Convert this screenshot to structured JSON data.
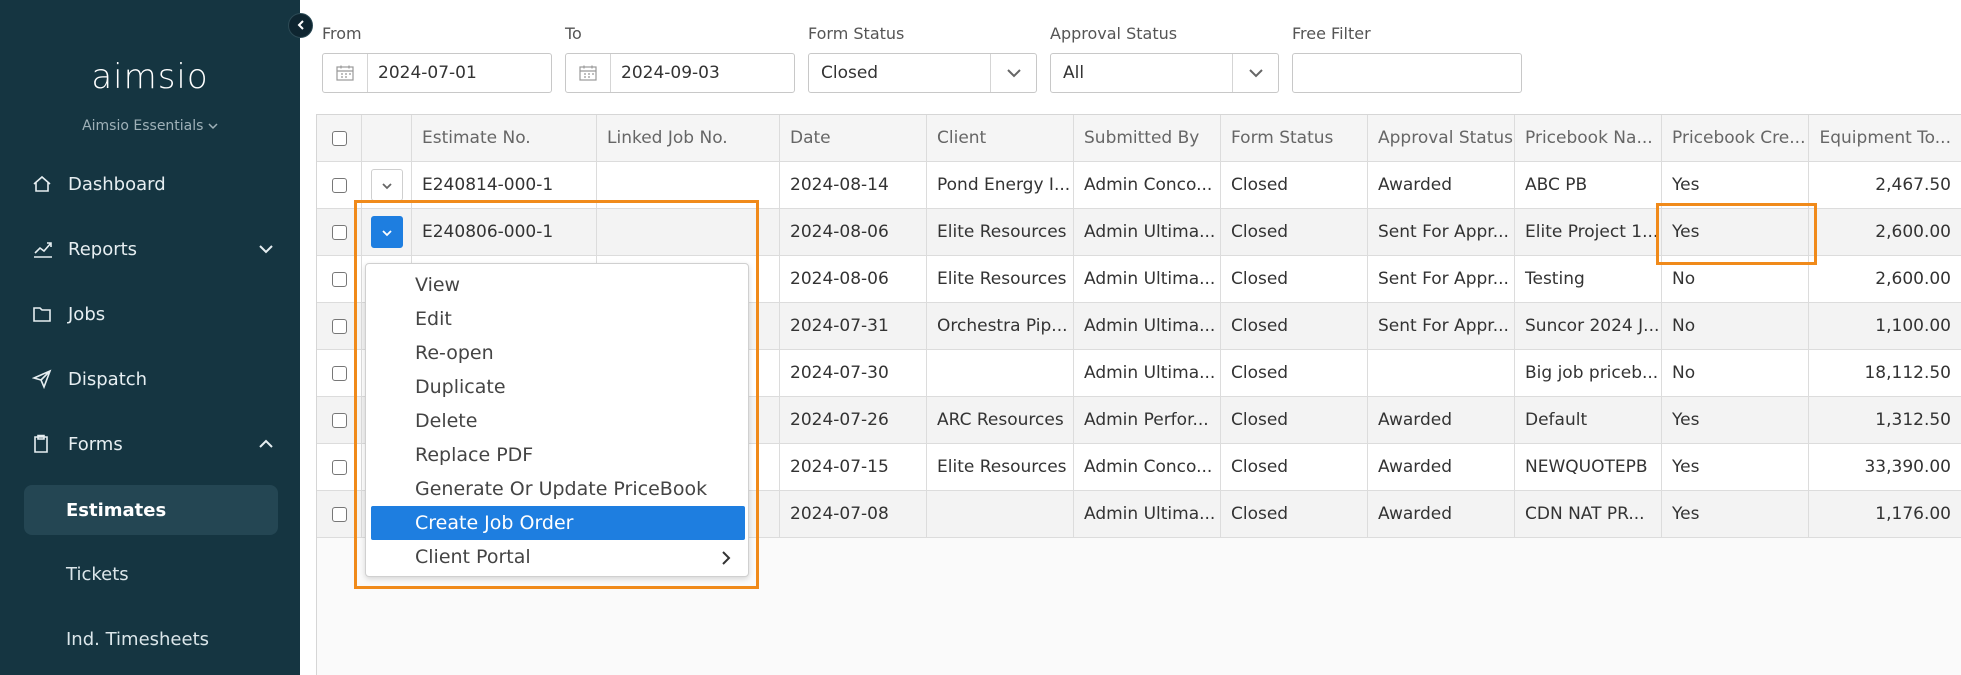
{
  "sidebar": {
    "logo": "aimsio",
    "org_name": "Aimsio Essentials",
    "nav": [
      {
        "label": "Dashboard",
        "icon": "home-icon"
      },
      {
        "label": "Reports",
        "icon": "chart-icon"
      },
      {
        "label": "Jobs",
        "icon": "folder-icon"
      },
      {
        "label": "Dispatch",
        "icon": "paper-plane-icon"
      },
      {
        "label": "Forms",
        "icon": "clipboard-icon"
      }
    ],
    "sub_items": [
      "Estimates",
      "Tickets",
      "Ind. Timesheets"
    ]
  },
  "filters": {
    "from_label": "From",
    "from_value": "2024-07-01",
    "to_label": "To",
    "to_value": "2024-09-03",
    "form_status_label": "Form Status",
    "form_status_value": "Closed",
    "approval_status_label": "Approval Status",
    "approval_status_value": "All",
    "free_filter_label": "Free Filter",
    "free_filter_value": ""
  },
  "table": {
    "columns": [
      "Estimate No.",
      "Linked Job No.",
      "Date",
      "Client",
      "Submitted By",
      "Form Status",
      "Approval Status",
      "Pricebook Na...",
      "Pricebook Cre...",
      "Equipment To..."
    ],
    "rows": [
      [
        "E240814-000-1",
        "",
        "2024-08-14",
        "Pond Energy I...",
        "Admin Conco...",
        "Closed",
        "Awarded",
        "ABC PB",
        "Yes",
        "2,467.50"
      ],
      [
        "E240806-000-1",
        "",
        "2024-08-06",
        "Elite Resources",
        "Admin Ultima...",
        "Closed",
        "Sent For Appr...",
        "Elite Project 1...",
        "Yes",
        "2,600.00"
      ],
      [
        "",
        "",
        "2024-08-06",
        "Elite Resources",
        "Admin Ultima...",
        "Closed",
        "Sent For Appr...",
        "Testing",
        "No",
        "2,600.00"
      ],
      [
        "",
        "",
        "2024-07-31",
        "Orchestra Pip...",
        "Admin Ultima...",
        "Closed",
        "Sent For Appr...",
        "Suncor 2024 J...",
        "No",
        "1,100.00"
      ],
      [
        "",
        "",
        "2024-07-30",
        "",
        "Admin Ultima...",
        "Closed",
        "",
        "Big job priceb...",
        "No",
        "18,112.50"
      ],
      [
        "",
        "",
        "2024-07-26",
        "ARC Resources",
        "Admin Perfor...",
        "Closed",
        "Awarded",
        "Default",
        "Yes",
        "1,312.50"
      ],
      [
        "",
        "",
        "2024-07-15",
        "Elite Resources",
        "Admin Conco...",
        "Closed",
        "Awarded",
        "NEWQUOTEPB",
        "Yes",
        "33,390.00"
      ],
      [
        "",
        "",
        "2024-07-08",
        "",
        "Admin Ultima...",
        "Closed",
        "Awarded",
        "CDN NAT PR...",
        "Yes",
        "1,176.00"
      ]
    ]
  },
  "context_menu": {
    "items": [
      "View",
      "Edit",
      "Re-open",
      "Duplicate",
      "Delete",
      "Replace PDF",
      "Generate Or Update PriceBook",
      "Create Job Order",
      "Client Portal"
    ],
    "active": "Create Job Order"
  },
  "colors": {
    "sidebar_bg": "#153541",
    "accent_blue": "#1e7ee0",
    "highlight_orange": "#f08a1a"
  }
}
